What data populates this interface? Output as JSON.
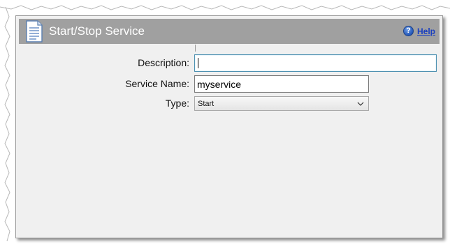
{
  "header": {
    "title": "Start/Stop Service",
    "help_label": "Help",
    "help_icon_glyph": "?",
    "help_icon": "help-question-icon",
    "doc_icon": "document-icon"
  },
  "form": {
    "description_label": "Description:",
    "description_value": "",
    "service_name_label": "Service Name:",
    "service_name_value": "myservice",
    "type_label": "Type:",
    "type_value": "Start"
  },
  "colors": {
    "header_bg": "#a0a0a0",
    "panel_bg": "#f0f0f0",
    "help_link": "#1a3fbf",
    "focus_border": "#4a8fb0"
  }
}
